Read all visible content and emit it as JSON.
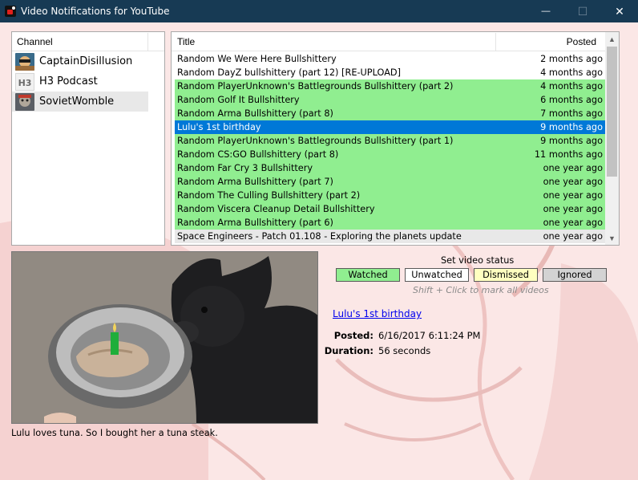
{
  "window": {
    "title": "Video Notifications for YouTube",
    "minimize_icon": "minimize-icon",
    "maximize_icon": "maximize-icon",
    "close_icon": "close-icon",
    "minimize_glyph": "—",
    "maximize_glyph": "☐",
    "close_glyph": "✕"
  },
  "channels": {
    "header": "Channel",
    "items": [
      {
        "label": "CaptainDisillusion",
        "avatar": "captain-disillusion-avatar",
        "selected": false
      },
      {
        "label": "H3 Podcast",
        "avatar": "h3-podcast-avatar",
        "selected": false
      },
      {
        "label": "SovietWomble",
        "avatar": "soviet-womble-avatar",
        "selected": true
      }
    ]
  },
  "videos": {
    "header_title": "Title",
    "header_posted": "Posted",
    "rows": [
      {
        "title": "Random We Were Here Bullshittery",
        "posted": "2 months ago",
        "status": "unwatched"
      },
      {
        "title": "Random DayZ bullshittery (part 12) [RE-UPLOAD]",
        "posted": "4 months ago",
        "status": "unwatched"
      },
      {
        "title": "Random PlayerUnknown's Battlegrounds Bullshittery (part 2)",
        "posted": "4 months ago",
        "status": "watched"
      },
      {
        "title": "Random Golf It Bullshittery",
        "posted": "6 months ago",
        "status": "watched"
      },
      {
        "title": "Random Arma Bullshittery (part 8)",
        "posted": "7 months ago",
        "status": "watched"
      },
      {
        "title": "Lulu's 1st birthday",
        "posted": "9 months ago",
        "status": "selected"
      },
      {
        "title": "Random PlayerUnknown's Battlegrounds Bullshittery (part 1)",
        "posted": "9 months ago",
        "status": "watched"
      },
      {
        "title": "Random CS:GO Bullshittery (part 8)",
        "posted": "11 months ago",
        "status": "watched"
      },
      {
        "title": "Random Far Cry 3 Bullshittery",
        "posted": "one year ago",
        "status": "watched"
      },
      {
        "title": "Random Arma Bullshittery (part 7)",
        "posted": "one year ago",
        "status": "watched"
      },
      {
        "title": "Random The Culling Bullshittery (part 2)",
        "posted": "one year ago",
        "status": "watched"
      },
      {
        "title": "Random Viscera Cleanup Detail Bullshittery",
        "posted": "one year ago",
        "status": "watched"
      },
      {
        "title": "Random Arma Bullshittery (part 6)",
        "posted": "one year ago",
        "status": "watched"
      },
      {
        "title": "Space Engineers - Patch 01.108 - Exploring the planets update",
        "posted": "one year ago",
        "status": "last"
      }
    ],
    "scroll_up_glyph": "▲",
    "scroll_down_glyph": "▼"
  },
  "details": {
    "thumbnail": "video-thumbnail-dog-with-tuna-steak",
    "description": "Lulu loves tuna. So I bought her a tuna steak.",
    "set_status_label": "Set video status",
    "buttons": {
      "watched": "Watched",
      "unwatched": "Unwatched",
      "dismissed": "Dismissed",
      "ignored": "Ignored"
    },
    "hint": "Shift + Click to mark all videos",
    "video_title": "Lulu's 1st birthday",
    "posted_label": "Posted:",
    "posted_value": "6/16/2017 6:11:24 PM",
    "duration_label": "Duration:",
    "duration_value": "56 seconds"
  },
  "colors": {
    "titlebar": "#173a54",
    "watched": "#90ee90",
    "selected": "#0078d7",
    "dismissed": "#ffffc0",
    "ignored": "#d3d3d3",
    "background": "#fbe7e6"
  }
}
